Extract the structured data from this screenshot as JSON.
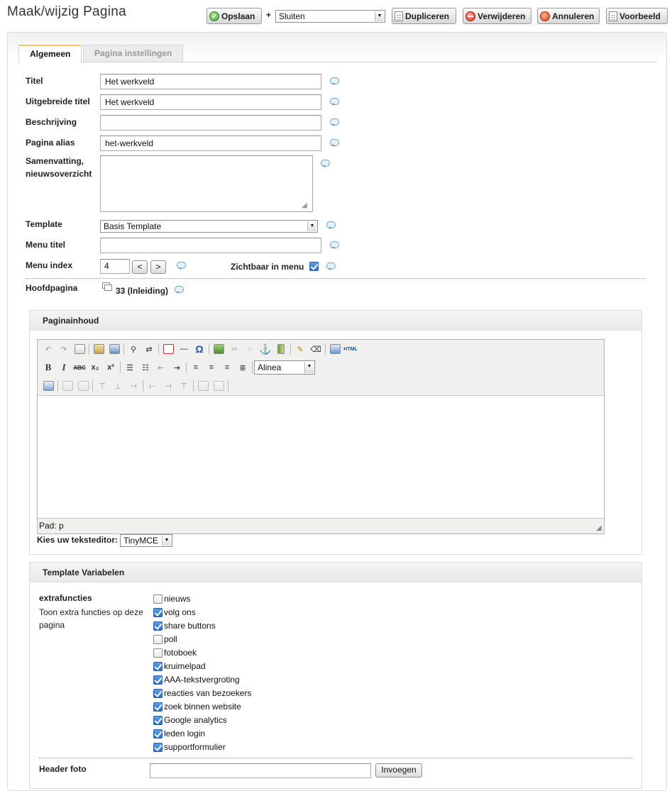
{
  "header": {
    "title": "Maak/wijzig Pagina",
    "save_label": "Opslaan",
    "plus": "+",
    "after_save_value": "Sluiten",
    "duplicate_label": "Dupliceren",
    "delete_label": "Verwijderen",
    "cancel_label": "Annuleren",
    "preview_label": "Voorbeeld"
  },
  "tabs": {
    "general": "Algemeen",
    "settings": "Pagina instellingen"
  },
  "form": {
    "title_label": "Titel",
    "title_value": "Het werkveld",
    "longtitle_label": "Uitgebreide titel",
    "longtitle_value": "Het werkveld",
    "description_label": "Beschrijving",
    "description_value": "",
    "alias_label": "Pagina alias",
    "alias_value": "het-werkveld",
    "summary_label_1": "Samenvatting,",
    "summary_label_2": "nieuwsoverzicht",
    "summary_value": "",
    "template_label": "Template",
    "template_value": "Basis Template",
    "menutitle_label": "Menu titel",
    "menutitle_value": "",
    "menuindex_label": "Menu index",
    "menuindex_value": "4",
    "menuindex_prev": "<",
    "menuindex_next": ">",
    "visible_label": "Zichtbaar in menu",
    "visible_checked": true,
    "parent_label": "Hoofdpagina",
    "parent_value": "33 (Inleiding)"
  },
  "content_section": {
    "heading": "Paginainhoud",
    "format_select": "Alinea",
    "status_path": "Pad: p",
    "editor_label": "Kies uw teksteditor:",
    "editor_value": "TinyMCE"
  },
  "toolbar_icons": {
    "row1": [
      "undo-icon",
      "redo-icon",
      "select-all-icon",
      "paste-icon",
      "paste-word-icon",
      "find-icon",
      "replace-icon",
      "image-broken-icon",
      "horizontal-rule-icon",
      "omega-icon",
      "insert-image-icon",
      "link-icon",
      "unlink-icon",
      "anchor-icon",
      "media-icon",
      "cleanup-icon",
      "eraser-icon",
      "fullscreen-icon",
      "html-icon"
    ],
    "row2": [
      "bold-icon",
      "italic-icon",
      "strikethrough-icon",
      "subscript-icon",
      "superscript-icon",
      "bullet-list-icon",
      "numbered-list-icon",
      "outdent-icon",
      "indent-icon",
      "align-left-icon",
      "align-center-icon",
      "align-right-icon",
      "align-justify-icon"
    ],
    "row3": [
      "table-icon",
      "row-props-icon",
      "cell-props-icon",
      "insert-row-before-icon",
      "insert-row-after-icon",
      "delete-row-icon",
      "insert-col-before-icon",
      "insert-col-after-icon",
      "delete-col-icon",
      "split-cells-icon",
      "merge-cells-icon"
    ]
  },
  "tv_section": {
    "heading": "Template Variabelen",
    "extra_label": "extrafuncties",
    "extra_desc": "Toon extra functies op deze pagina",
    "options": [
      {
        "label": "nieuws",
        "checked": false
      },
      {
        "label": "volg ons",
        "checked": true
      },
      {
        "label": "share buttons",
        "checked": true
      },
      {
        "label": "poll",
        "checked": false
      },
      {
        "label": "fotoboek",
        "checked": false
      },
      {
        "label": "kruimelpad",
        "checked": true
      },
      {
        "label": "AAA-tekstvergroting",
        "checked": true
      },
      {
        "label": "reacties van bezoekers",
        "checked": true
      },
      {
        "label": "zoek binnen website",
        "checked": true
      },
      {
        "label": "Google analytics",
        "checked": true
      },
      {
        "label": "leden login",
        "checked": true
      },
      {
        "label": "supportformulier",
        "checked": true
      }
    ],
    "header_photo_label": "Header foto",
    "header_photo_value": "",
    "insert_label": "Invoegen"
  },
  "colors": {
    "tab_accent": "#f3c66b",
    "checkbox_on": "#2b6fc2",
    "help_icon": "#6fa2c6"
  }
}
